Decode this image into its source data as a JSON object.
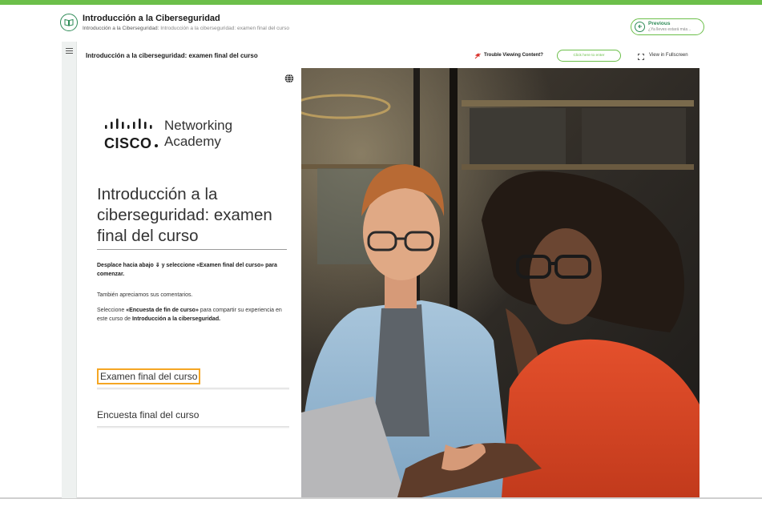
{
  "header": {
    "course_title": "Introducción a la Ciberseguridad",
    "breadcrumb_root": "Introducción a la Ciberseguridad:",
    "breadcrumb_current": "Introducción a la ciberseguridad: examen final del curso",
    "previous_label": "Previous",
    "previous_sub": "¿Ya lleves estará más..."
  },
  "toolbar": {
    "content_title": "Introducción a la ciberseguridad: examen final del curso",
    "trouble_text": "Trouble Viewing Content?",
    "click_here_label": "Click here to enter",
    "fullscreen_label": "View in Fullscreen"
  },
  "panel": {
    "logo_cisco": "CISCO",
    "logo_networking": "Networking",
    "logo_academy": "Academy",
    "big_title": "Introducción a la ciberseguridad: examen final del curso",
    "instruction_scroll": "Desplace hacia abajo ⇓ y seleccione «Examen final del curso» para comenzar.",
    "instruction_feedback": "También apreciamos sus comentarios.",
    "instruction_survey_pre": "Seleccione ",
    "instruction_survey_bold": "«Encuesta de fin de curso»",
    "instruction_survey_mid": " para compartir su experiencia en este curso de ",
    "instruction_survey_course": "Introducción a la ciberseguridad.",
    "menu_exam": "Examen final del curso",
    "menu_survey": "Encuesta final del curso"
  },
  "icons": {
    "header": "book-icon",
    "previous": "arrow-left-icon",
    "menu": "hamburger-icon",
    "trouble": "flag-icon",
    "fullscreen": "expand-icon",
    "language": "globe-icon"
  },
  "colors": {
    "accent": "#6cbf4a",
    "accent_dark": "#2e8b57",
    "focus_outline": "#f5a623"
  }
}
